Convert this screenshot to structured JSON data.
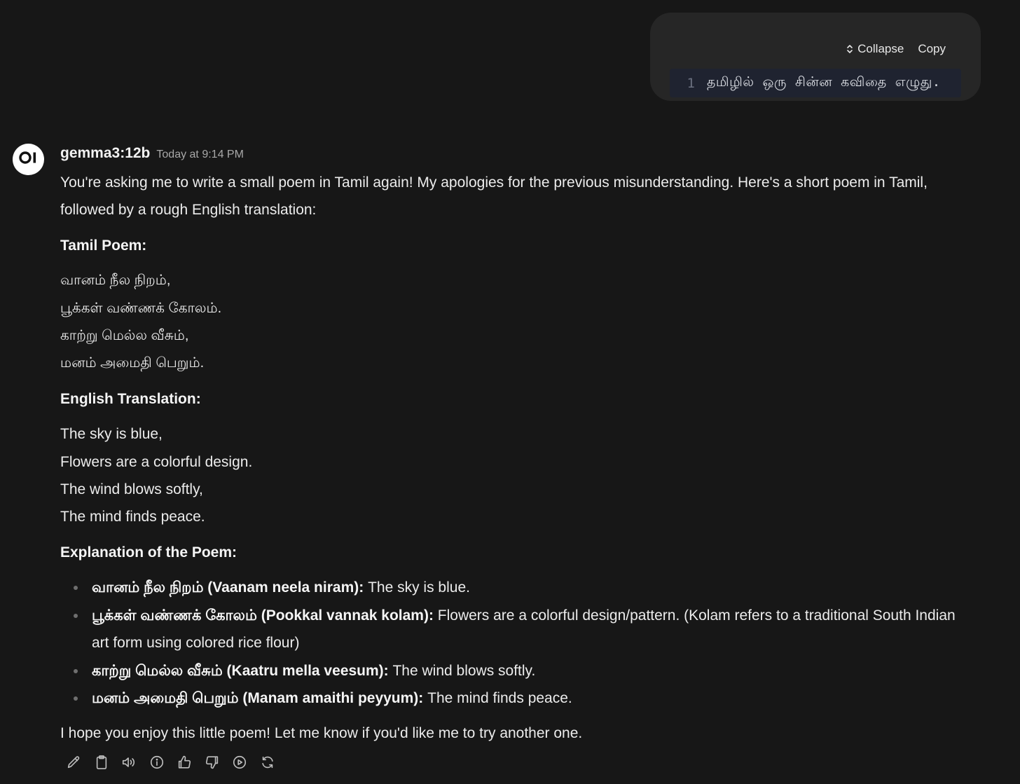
{
  "user_message": {
    "toolbar": {
      "collapse_label": "Collapse",
      "copy_label": "Copy"
    },
    "code_line_number": "1",
    "code_text": "தமிழில் ஒரு சின்ன கவிதை எழுது."
  },
  "assistant": {
    "avatar_text": "OI",
    "model_name": "gemma3:12b",
    "timestamp": "Today at 9:14 PM",
    "intro": "You're asking me to write a small poem in Tamil again! My apologies for the previous misunderstanding. Here's a short poem in Tamil, followed by a rough English translation:",
    "tamil_heading": "Tamil Poem:",
    "tamil_lines": [
      "வானம் நீல நிறம்,",
      "பூக்கள் வண்ணக் கோலம்.",
      "காற்று மெல்ல வீசும்,",
      "மனம் அமைதி பெறும்."
    ],
    "english_heading": "English Translation:",
    "english_lines": [
      "The sky is blue,",
      "Flowers are a colorful design.",
      "The wind blows softly,",
      "The mind finds peace."
    ],
    "explanation_heading": "Explanation of the Poem:",
    "explanation_items": [
      {
        "term": "வானம் நீல நிறம் (Vaanam neela niram):",
        "meaning": " The sky is blue."
      },
      {
        "term": "பூக்கள் வண்ணக் கோலம் (Pookkal vannak kolam):",
        "meaning": " Flowers are a colorful design/pattern. (Kolam refers to a traditional South Indian art form using colored rice flour)"
      },
      {
        "term": "காற்று மெல்ல வீசும் (Kaatru mella veesum):",
        "meaning": " The wind blows softly."
      },
      {
        "term": "மனம் அமைதி பெறும் (Manam amaithi peyyum):",
        "meaning": " The mind finds peace."
      }
    ],
    "closing": "I hope you enjoy this little poem! Let me know if you'd like me to try another one."
  },
  "actions": [
    {
      "icon": "pencil-icon"
    },
    {
      "icon": "clipboard-icon"
    },
    {
      "icon": "speaker-icon"
    },
    {
      "icon": "info-icon"
    },
    {
      "icon": "thumbs-up-icon"
    },
    {
      "icon": "thumbs-down-icon"
    },
    {
      "icon": "play-icon"
    },
    {
      "icon": "regenerate-icon"
    }
  ],
  "colors": {
    "background": "#171717",
    "bubble": "#262626",
    "code_line_bg": "#1f2330",
    "text": "#ececec",
    "muted": "#a8a8a8"
  }
}
